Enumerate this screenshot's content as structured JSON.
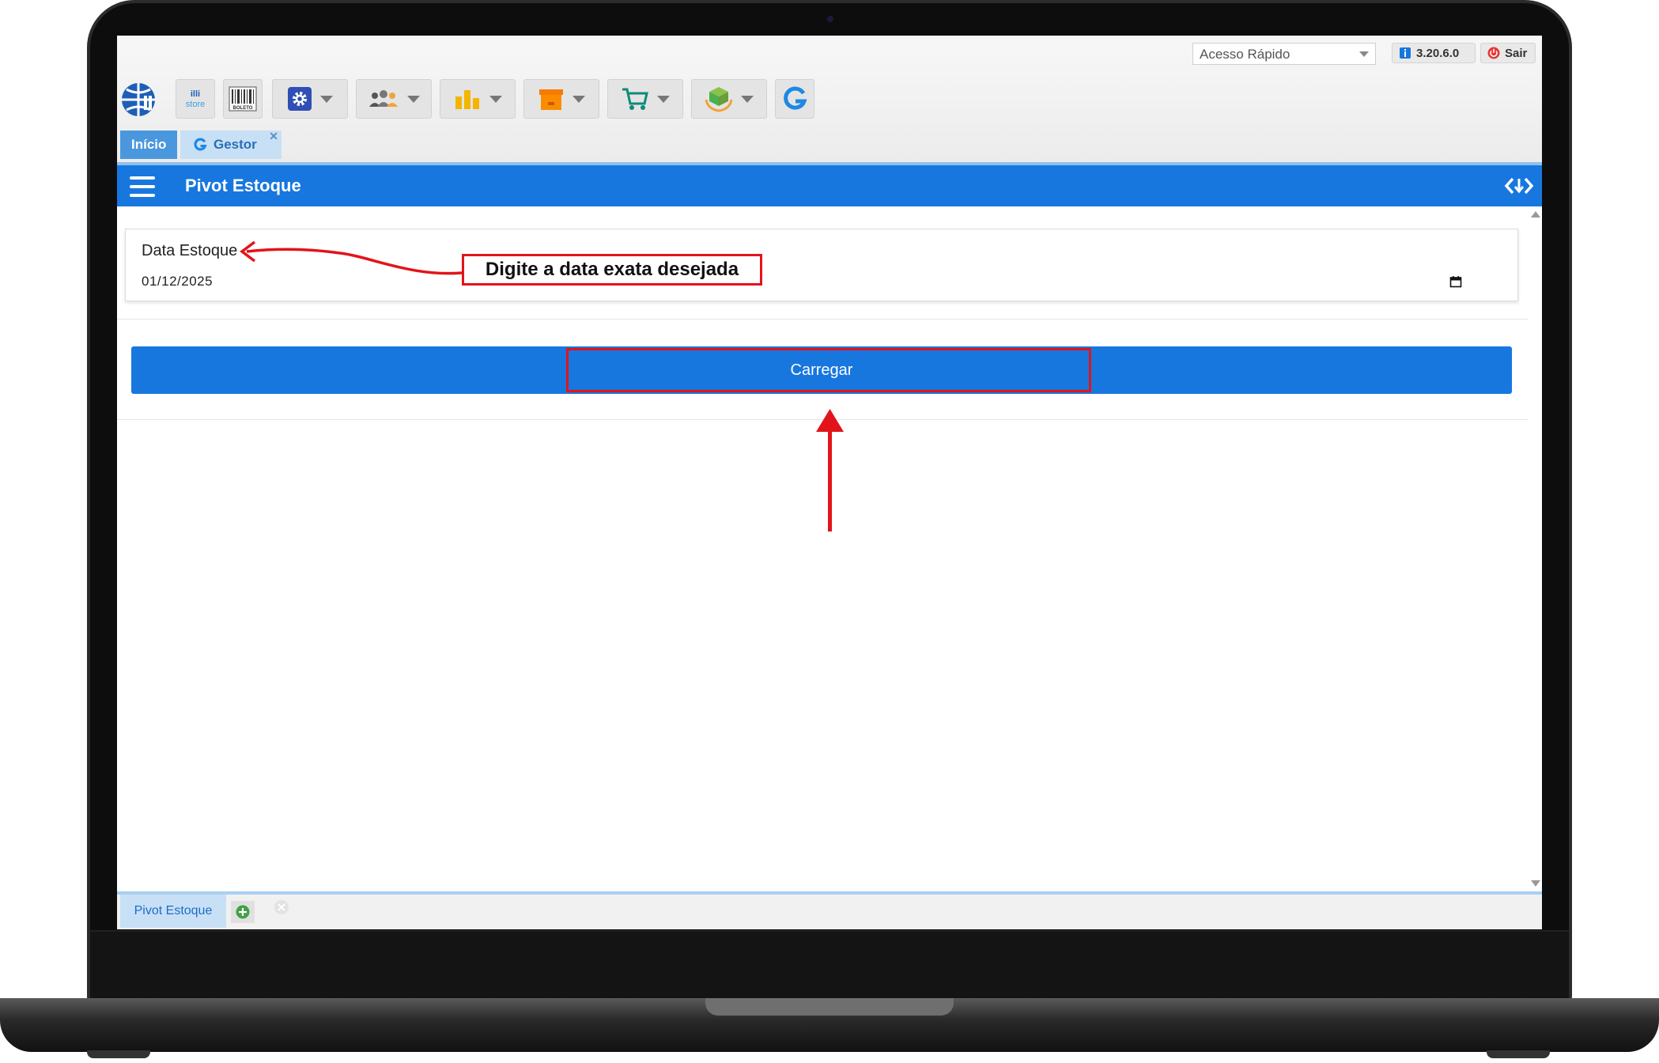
{
  "header": {
    "quick_access": "Acesso Rápido",
    "version": "3.20.6.0",
    "exit_label": "Sair"
  },
  "toolbar": {
    "store_label": "illi store",
    "boleto_label": "BOLETO"
  },
  "tabs": [
    {
      "label": "Início"
    },
    {
      "label": "Gestor"
    }
  ],
  "page": {
    "title": "Pivot Estoque"
  },
  "form": {
    "date_label": "Data Estoque",
    "date_value": "01/12/2025",
    "load_button": "Carregar"
  },
  "annotation": {
    "callout": "Digite a data exata desejada"
  },
  "footer": {
    "tab_label": "Pivot Estoque"
  },
  "colors": {
    "primary": "#1777df",
    "annotation": "#e2141b",
    "tab_active": "#4a97dd",
    "tab_inactive": "#c7e0f6"
  }
}
